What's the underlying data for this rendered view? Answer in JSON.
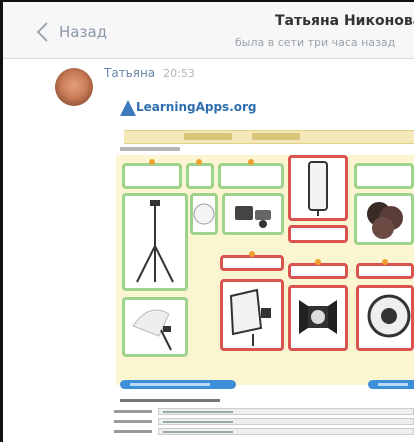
{
  "header": {
    "back_label": "Назад",
    "contact_name": "Татьяна Никонова",
    "contact_status": "была в сети три часа назад"
  },
  "message": {
    "sender": "Татьяна",
    "time": "20:53"
  },
  "attachment": {
    "site_logo_text": "LearningApps.org",
    "accent_color": "#3d8fd9",
    "card_border_green": "#9ed38e",
    "card_border_red": "#d9534f",
    "board_background": "#fbf5d2"
  },
  "colors": {
    "link": "#6a86a8",
    "muted": "#9aa3ad"
  }
}
